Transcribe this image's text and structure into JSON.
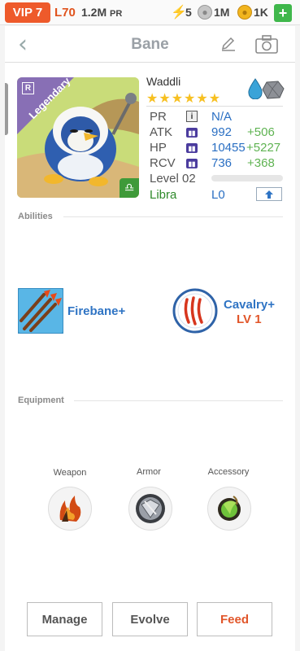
{
  "status_bar": {
    "vip": "VIP 7",
    "level": "L70",
    "power": "1.2M",
    "power_unit": "PR",
    "energy": "5",
    "silver": "1M",
    "gold": "1K",
    "add_label": "+"
  },
  "header": {
    "title": "Bane",
    "back_icon": "chevron-left-icon",
    "edit_icon": "pencil-icon",
    "camera_icon": "camera-icon"
  },
  "hero": {
    "rarity_badge": "Legendary",
    "tier_badge": "R",
    "name": "Waddli",
    "stars": "★★★★★★",
    "star_count": 6,
    "elements": [
      "water-drop-icon",
      "stone-icon"
    ],
    "stats": [
      {
        "label": "PR",
        "value": "N/A",
        "bonus": ""
      },
      {
        "label": "ATK",
        "value": "992",
        "bonus": "+506"
      },
      {
        "label": "HP",
        "value": "10455",
        "bonus": "+5227"
      },
      {
        "label": "RCV",
        "value": "736",
        "bonus": "+368"
      }
    ],
    "level_label": "Level 02",
    "xp_progress": 0,
    "sign": "Libra",
    "sign_level": "L0"
  },
  "abilities": {
    "section_label": "Abilities",
    "items": [
      {
        "name": "Firebane+",
        "level": "",
        "icon": "fire-arrows-icon"
      },
      {
        "name": "Cavalry+",
        "level": "LV 1",
        "icon": "claw-marks-icon"
      }
    ]
  },
  "equipment": {
    "section_label": "Equipment",
    "slots": [
      {
        "label": "Weapon",
        "icon": "flame-claw-icon"
      },
      {
        "label": "Armor",
        "icon": "steel-shield-icon"
      },
      {
        "label": "Accessory",
        "icon": "green-orb-icon"
      }
    ]
  },
  "actions": {
    "manage": "Manage",
    "evolve": "Evolve",
    "feed": "Feed"
  },
  "colors": {
    "vip": "#ee5a2b",
    "accent_blue": "#2f74c4",
    "bonus_green": "#5fb352",
    "feed_orange": "#e1562a"
  }
}
